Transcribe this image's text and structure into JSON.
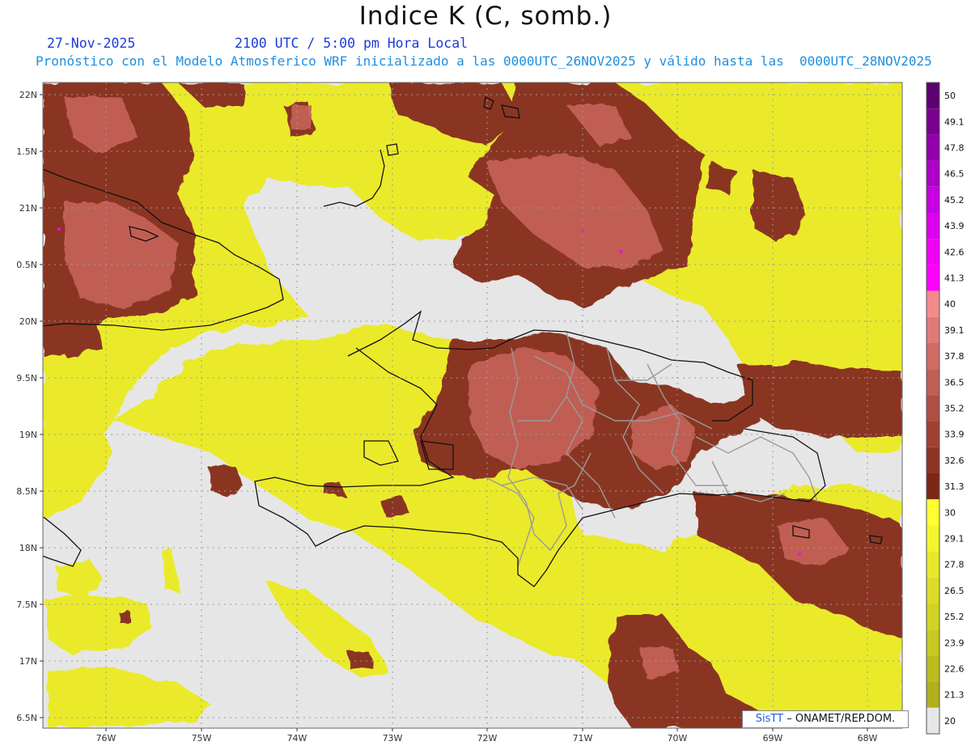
{
  "title": "Indice K (C, somb.)",
  "header": {
    "date": "27-Nov-2025",
    "time": "2100 UTC / 5:00 pm Hora Local",
    "description": "Pronóstico con el Modelo Atmosferico WRF inicializado a las 0000UTC_26NOV2025 y válido hasta las  0000UTC_28NOV2025"
  },
  "footer": {
    "brand": "SisTT",
    "agency": "– ONAMET/REP.DOM."
  },
  "axes": {
    "lat_labels": [
      "22N",
      "1.5N",
      "21N",
      "0.5N",
      "20N",
      "9.5N",
      "19N",
      "8.5N",
      "18N",
      "7.5N",
      "17N",
      "6.5N"
    ],
    "lon_labels": [
      "76W",
      "75W",
      "74W",
      "73W",
      "72W",
      "71W",
      "70W",
      "69W",
      "68W"
    ]
  },
  "colorbar": {
    "labels": [
      "50",
      "49.1",
      "47.8",
      "46.5",
      "45.2",
      "43.9",
      "42.6",
      "41.3",
      "40",
      "39.1",
      "37.8",
      "36.5",
      "35.2",
      "33.9",
      "32.6",
      "31.3",
      "30",
      "29.1",
      "27.8",
      "26.5",
      "25.2",
      "23.9",
      "22.6",
      "21.3",
      "20"
    ],
    "colors": [
      "#5c0070",
      "#7a008e",
      "#9300ad",
      "#ad00c8",
      "#c600e0",
      "#dd00ee",
      "#ef00f5",
      "#ff00ff",
      "#f48a8a",
      "#e07a78",
      "#d06a64",
      "#c05e54",
      "#b04e44",
      "#a04034",
      "#8e3426",
      "#7c2716",
      "#ffff33",
      "#f4f42e",
      "#e8e82b",
      "#dcdc28",
      "#d2d225",
      "#c8c822",
      "#bcbc1f",
      "#b0b01c",
      "#e6e6e6"
    ],
    "palette": {
      "missing": "#e6e6e6",
      "k_20_30": "#eaea2a",
      "k_30_40": "#8a3422",
      "k_high": "#c8645a",
      "k_extreme": "#ff00ff",
      "coast": "#111111",
      "provinces": "#9a9a9a"
    }
  }
}
